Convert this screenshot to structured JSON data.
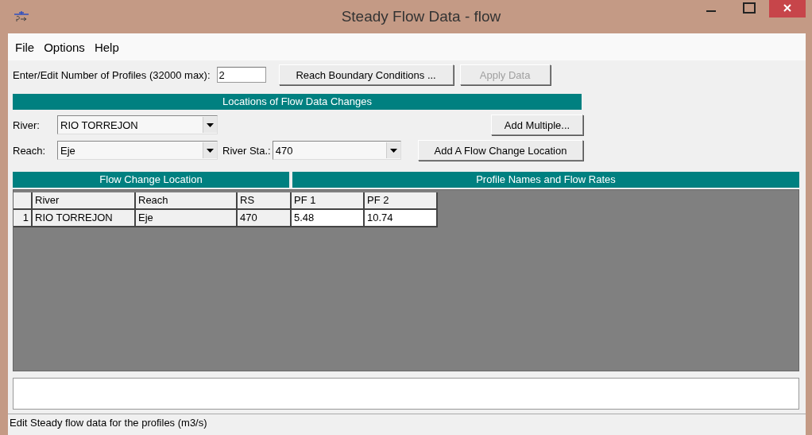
{
  "window": {
    "title": "Steady Flow Data - flow"
  },
  "menu": [
    "File",
    "Options",
    "Help"
  ],
  "profiles": {
    "label": "Enter/Edit Number of Profiles (32000 max):",
    "value": "2"
  },
  "top_buttons": [
    {
      "label": "Reach Boundary Conditions ...",
      "disabled": false
    },
    {
      "label": "Apply Data",
      "disabled": true
    }
  ],
  "locations_header": "Locations of Flow Data Changes",
  "river": {
    "label": "River:",
    "value": "RIO TORREJON"
  },
  "add_multiple": "Add Multiple...",
  "reach": {
    "label": "Reach:",
    "value": "Eje"
  },
  "river_sta": {
    "label": "River Sta.:",
    "value": "470"
  },
  "add_location": "Add A Flow Change Location",
  "table": {
    "group_headers": [
      "Flow Change Location",
      "Profile Names and Flow Rates"
    ],
    "columns": [
      "River",
      "Reach",
      "RS",
      "PF 1",
      "PF 2"
    ],
    "rows": [
      {
        "number": "1",
        "cells": [
          "RIO TORREJON",
          "Eje",
          "470",
          "5.48",
          "10.74"
        ]
      }
    ]
  },
  "status_bar": "Edit Steady flow data for the profiles (m3/s)"
}
